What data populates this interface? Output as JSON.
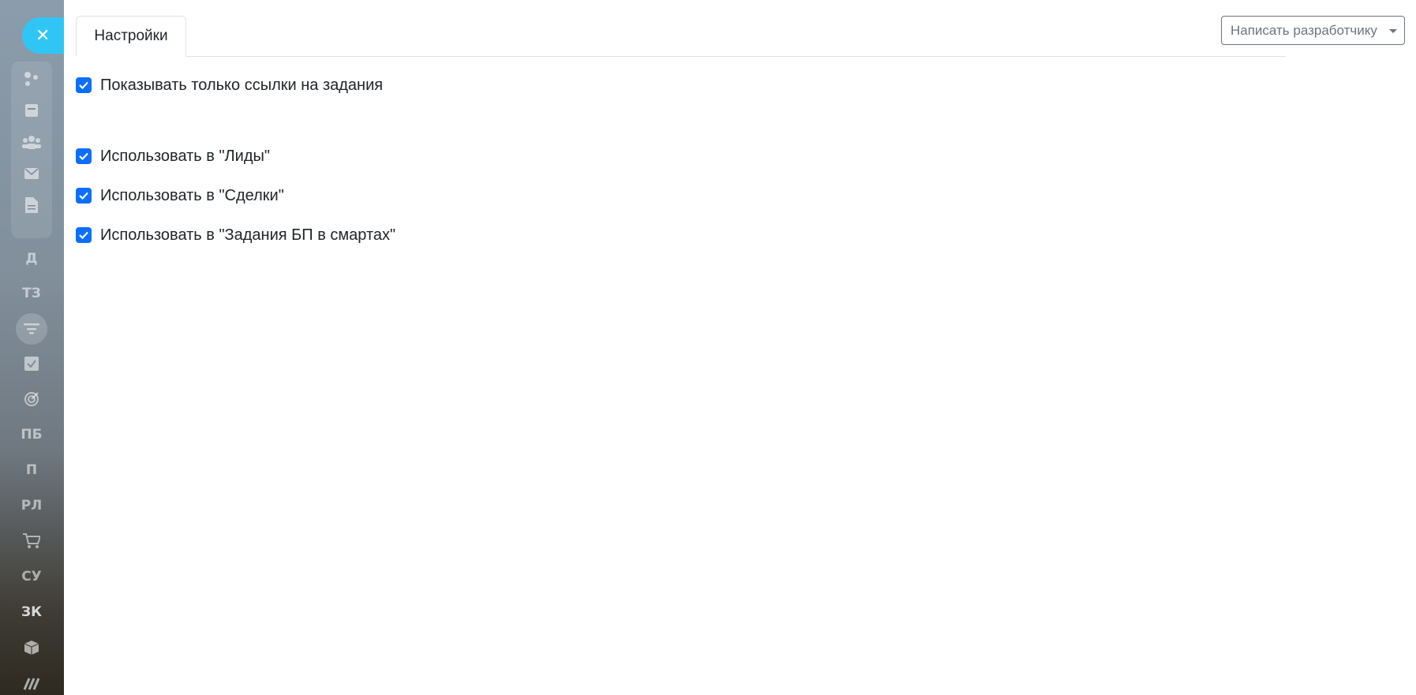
{
  "panel": {
    "tab_settings": "Настройки",
    "dev_button": "Написать разработчику"
  },
  "settings": {
    "items": [
      {
        "label": "Показывать только ссылки на задания",
        "checked": true
      },
      {
        "label": "Использовать в \"Лиды\"",
        "checked": true
      },
      {
        "label": "Использовать в \"Сделки\"",
        "checked": true
      },
      {
        "label": "Использовать в \"Задания БП в смартах\"",
        "checked": true
      }
    ]
  },
  "sidebar": {
    "close_icon": "✕",
    "items": [
      {
        "icon": "connections-icon"
      },
      {
        "icon": "calendar-icon"
      },
      {
        "icon": "contacts-icon"
      },
      {
        "icon": "mail-icon"
      },
      {
        "icon": "document-icon"
      },
      {
        "label": "Д"
      },
      {
        "label": "ТЗ"
      },
      {
        "icon": "funnel-icon"
      },
      {
        "icon": "task-check-icon"
      },
      {
        "icon": "target-icon"
      },
      {
        "label": "ПБ"
      },
      {
        "label": "П"
      },
      {
        "label": "РЛ"
      },
      {
        "icon": "cart-icon"
      },
      {
        "label": "СУ"
      },
      {
        "label": "ЗК"
      },
      {
        "icon": "box-icon"
      },
      {
        "icon": "brand-logo-icon"
      }
    ]
  },
  "colors": {
    "accent": "#0d6efd",
    "close_button": "#2fc6f6",
    "text": "#212529",
    "muted": "#6c757d"
  }
}
